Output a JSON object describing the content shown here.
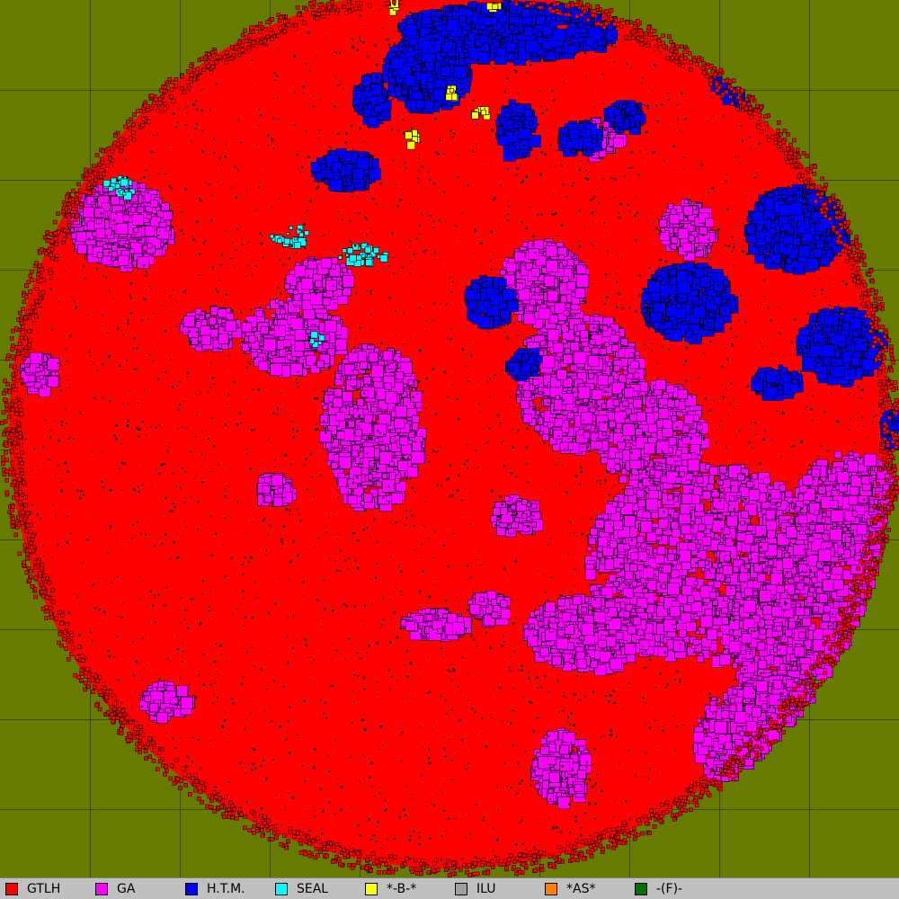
{
  "map": {
    "background_color": "#667b00",
    "grid_color": "#3d4a00",
    "base_color": "#ff0000",
    "speckle_color": "#000000"
  },
  "legend": {
    "items": [
      {
        "label": "GTLH",
        "color": "#ff0000"
      },
      {
        "label": "GA",
        "color": "#ff00ff"
      },
      {
        "label": "H.T.M.",
        "color": "#0000ff"
      },
      {
        "label": "SEAL",
        "color": "#00ffff"
      },
      {
        "label": "*-B-*",
        "color": "#ffff00"
      },
      {
        "label": "ILU",
        "color": "#a0a0a0"
      },
      {
        "label": "*AS*",
        "color": "#ff8000"
      },
      {
        "label": "-(F)-",
        "color": "#007000"
      }
    ]
  }
}
